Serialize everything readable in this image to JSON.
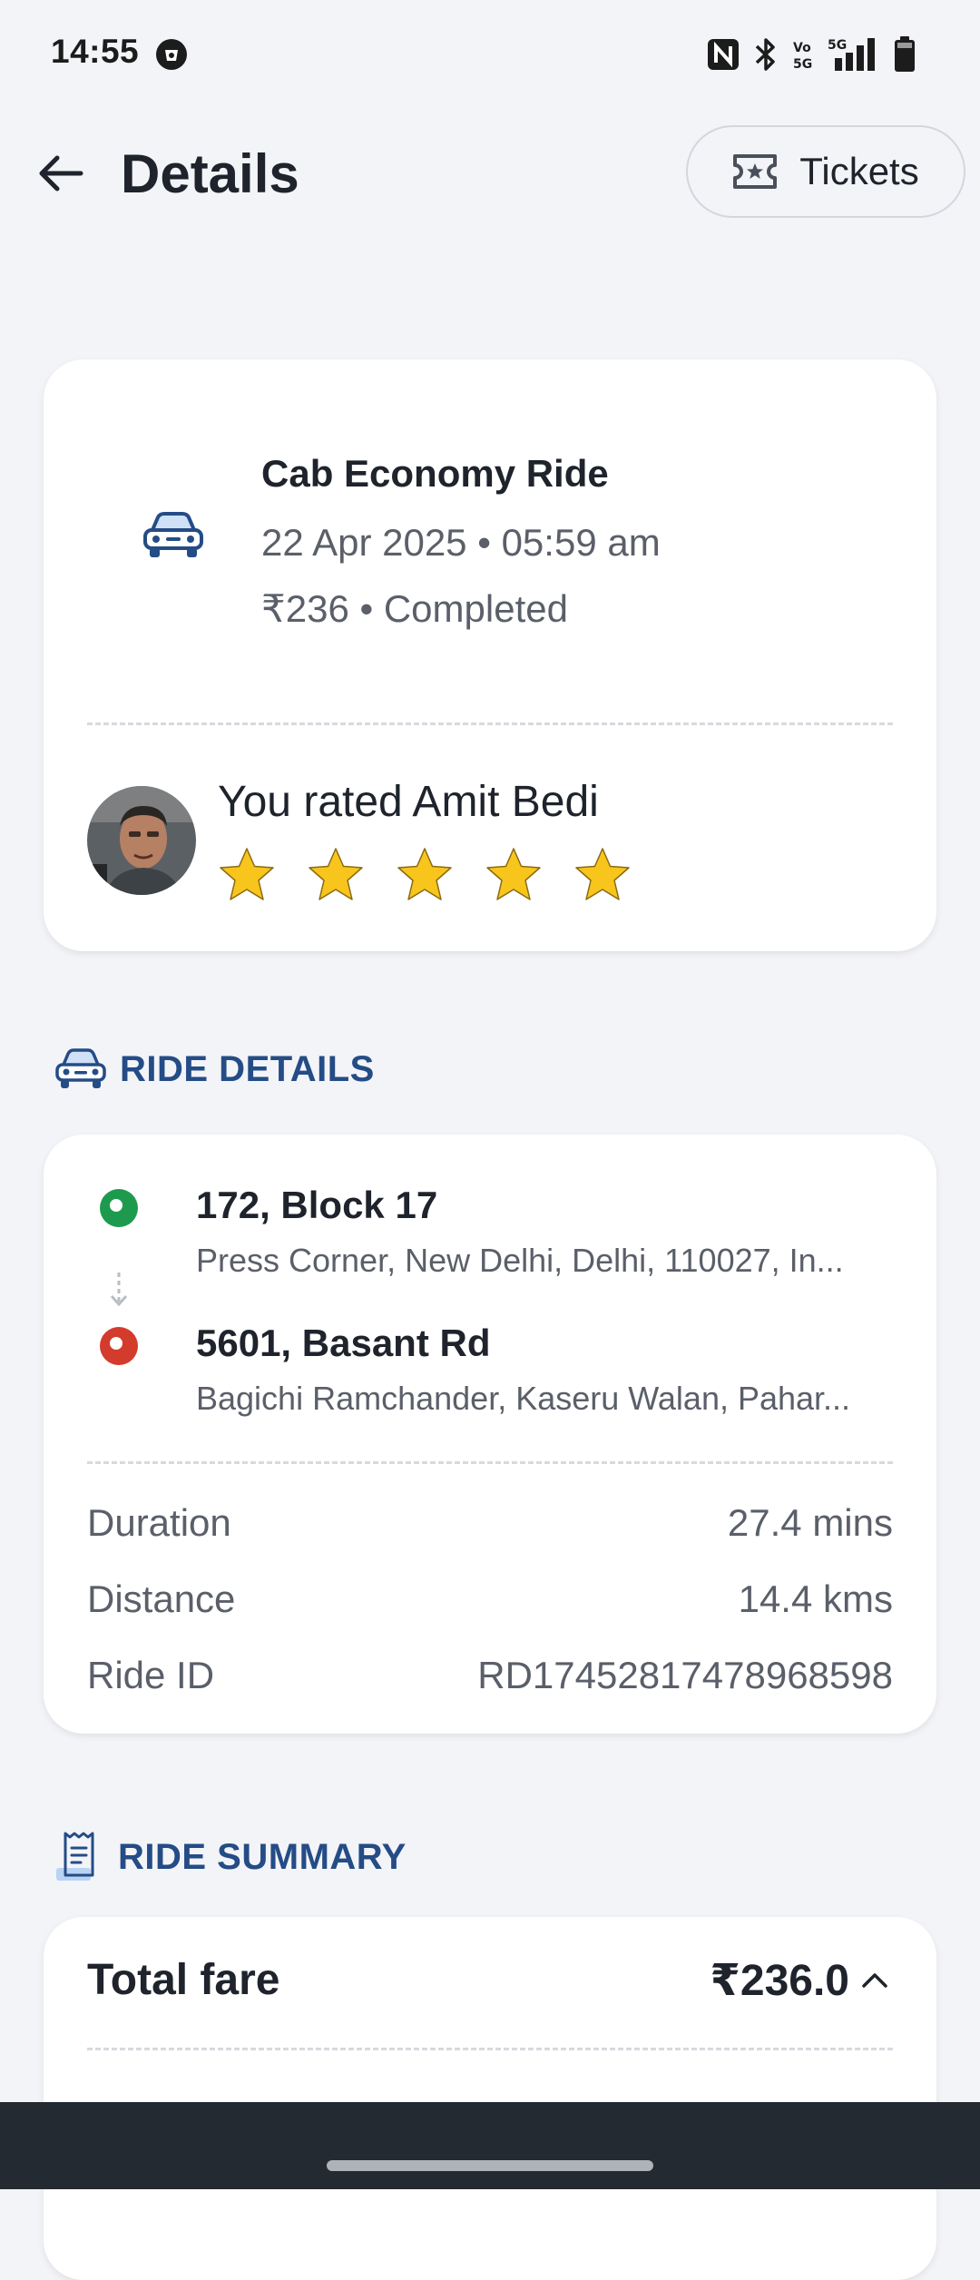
{
  "status_bar": {
    "time": "14:55",
    "icons": [
      "app-notification-icon",
      "nfc-icon",
      "bluetooth-icon",
      "volte-icon",
      "5g-signal-icon",
      "battery-icon"
    ]
  },
  "header": {
    "title": "Details",
    "tickets_label": "Tickets"
  },
  "ride": {
    "title": "Cab Economy Ride",
    "datetime": "22 Apr 2025 • 05:59 am",
    "fare_status": "₹236 • Completed",
    "rating_text": "You rated Amit Bedi",
    "stars": 5
  },
  "ride_details": {
    "section_title": "RIDE DETAILS",
    "pickup": {
      "name": "172, Block 17",
      "address": "Press Corner, New Delhi, Delhi, 110027, In..."
    },
    "drop": {
      "name": "5601, Basant Rd",
      "address": "Bagichi Ramchander, Kaseru Walan, Pahar..."
    },
    "rows": [
      {
        "label": "Duration",
        "value": "27.4 mins"
      },
      {
        "label": "Distance",
        "value": "14.4 kms"
      },
      {
        "label": "Ride ID",
        "value": "RD17452817478968598"
      }
    ]
  },
  "ride_summary": {
    "section_title": "RIDE SUMMARY",
    "total_label": "Total fare",
    "total_value": "₹236.0"
  },
  "colors": {
    "accent": "#244c86",
    "pickup": "#1e9a4f",
    "drop": "#d33b2c",
    "star": "#f8c51c"
  }
}
